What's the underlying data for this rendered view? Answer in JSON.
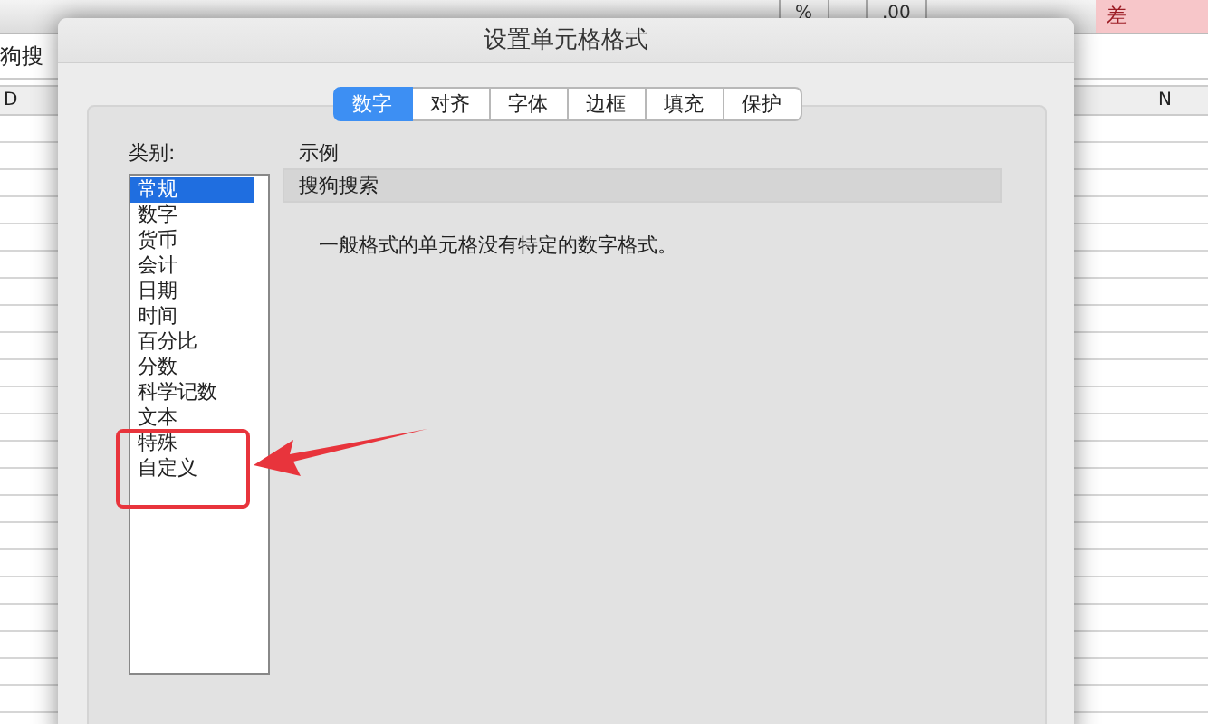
{
  "toolbar": {
    "items": [
      {
        "label": "%"
      },
      {
        "label": ".00"
      }
    ],
    "style_cell": "差"
  },
  "formula_bar": {
    "value": "狗搜"
  },
  "column_headers": [
    "D",
    "N"
  ],
  "dialog": {
    "title": "设置单元格格式",
    "tabs": [
      {
        "label": "数字",
        "selected": true
      },
      {
        "label": "对齐",
        "selected": false
      },
      {
        "label": "字体",
        "selected": false
      },
      {
        "label": "边框",
        "selected": false
      },
      {
        "label": "填充",
        "selected": false
      },
      {
        "label": "保护",
        "selected": false
      }
    ],
    "category_label": "类别:",
    "categories": [
      {
        "label": "常规",
        "selected": true
      },
      {
        "label": "数字",
        "selected": false
      },
      {
        "label": "货币",
        "selected": false
      },
      {
        "label": "会计",
        "selected": false
      },
      {
        "label": "日期",
        "selected": false
      },
      {
        "label": "时间",
        "selected": false
      },
      {
        "label": "百分比",
        "selected": false
      },
      {
        "label": "分数",
        "selected": false
      },
      {
        "label": "科学记数",
        "selected": false
      },
      {
        "label": "文本",
        "selected": false
      },
      {
        "label": "特殊",
        "selected": false
      },
      {
        "label": "自定义",
        "selected": false
      }
    ],
    "sample_label": "示例",
    "sample_value": "搜狗搜索",
    "description": "一般格式的单元格没有特定的数字格式。"
  }
}
